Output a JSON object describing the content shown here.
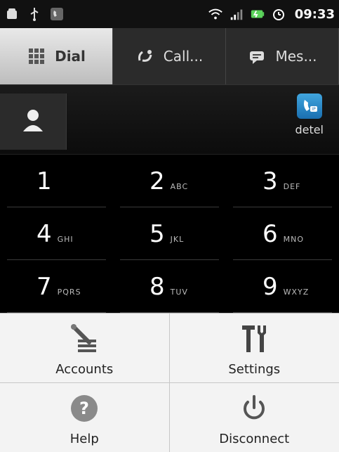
{
  "status": {
    "time": "09:33"
  },
  "tabs": [
    {
      "label": "Dial",
      "icon": "dialpad-icon"
    },
    {
      "label": "Call...",
      "icon": "call-log-icon"
    },
    {
      "label": "Mes...",
      "icon": "messages-icon"
    }
  ],
  "contact": {
    "carrier_label": "detel"
  },
  "dialpad": {
    "keys": [
      {
        "digit": "1",
        "letters": ""
      },
      {
        "digit": "2",
        "letters": "ABC"
      },
      {
        "digit": "3",
        "letters": "DEF"
      },
      {
        "digit": "4",
        "letters": "GHI"
      },
      {
        "digit": "5",
        "letters": "JKL"
      },
      {
        "digit": "6",
        "letters": "MNO"
      },
      {
        "digit": "7",
        "letters": "PQRS"
      },
      {
        "digit": "8",
        "letters": "TUV"
      },
      {
        "digit": "9",
        "letters": "WXYZ"
      }
    ]
  },
  "menu": {
    "items": [
      {
        "label": "Accounts",
        "icon": "accounts-icon"
      },
      {
        "label": "Settings",
        "icon": "settings-icon"
      },
      {
        "label": "Help",
        "icon": "help-icon"
      },
      {
        "label": "Disconnect",
        "icon": "power-icon"
      }
    ]
  },
  "colors": {
    "menu_bg": "#f3f3f3",
    "tab_active_bg": "#d9d9d9",
    "background": "#000000",
    "carrier_icon": "#2f8fcd"
  }
}
